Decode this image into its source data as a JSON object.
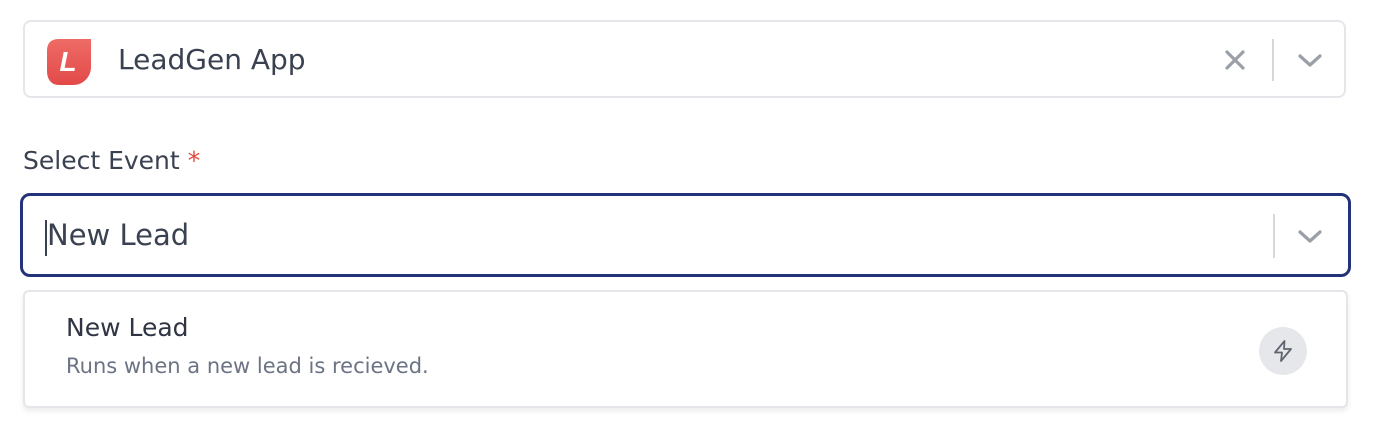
{
  "app_select": {
    "value": "LeadGen App",
    "logo_letter": "L",
    "logo_color": "#e8504e",
    "icons": {
      "clear": "close-icon",
      "expand": "chevron-down-icon"
    }
  },
  "event_field": {
    "label": "Select Event",
    "required_mark": "*",
    "value": "New Lead",
    "focus_color": "#22337a",
    "icons": {
      "expand": "chevron-down-icon"
    }
  },
  "dropdown": {
    "options": [
      {
        "title": "New Lead",
        "description": "Runs when a new lead is recieved.",
        "icon": "lightning-icon"
      }
    ]
  }
}
